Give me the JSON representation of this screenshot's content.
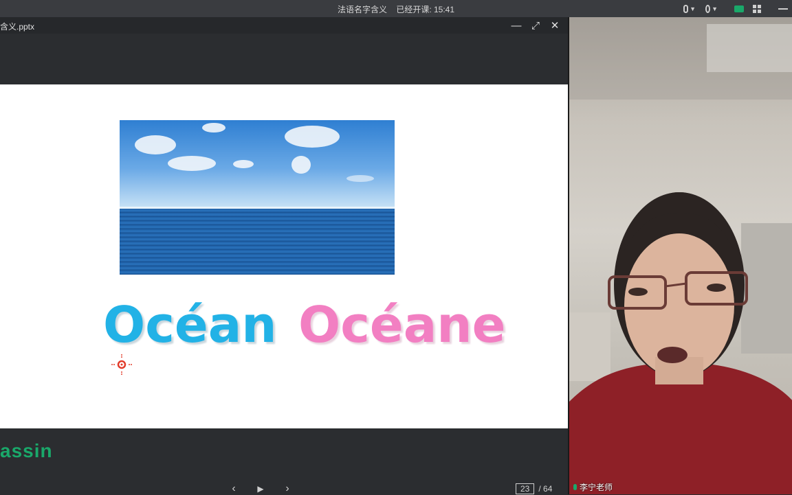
{
  "topbar": {
    "course_title": "法语名字含义",
    "status": "已经开课: 15:41"
  },
  "ppt": {
    "file_name": "含义.pptx",
    "minimize": "—",
    "maximize": "⤢",
    "close": "✕",
    "slide": {
      "word_left": "Océan",
      "word_right": "Océane"
    },
    "logo_text": "assin",
    "prev_label": "‹",
    "play_label": "▶",
    "next_label": "›",
    "current_page": "23",
    "total_pages": "/ 64"
  },
  "video": {
    "teacher_name": "李宁老师"
  },
  "colors": {
    "accent_green": "#1aa86a",
    "ocean_blue": "#22b2e6",
    "oceane_pink": "#f27fc2"
  }
}
